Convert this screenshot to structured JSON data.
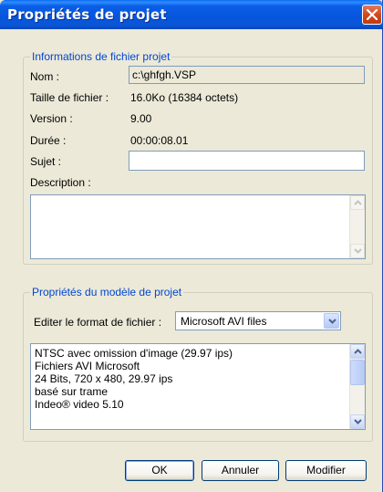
{
  "dialog": {
    "title": "Propriétés de projet"
  },
  "file_info": {
    "legend": "Informations de fichier projet",
    "name_label": "Nom :",
    "name_value": "c:\\ghfgh.VSP",
    "size_label": "Taille de fichier :",
    "size_value": "16.0Ko (16384 octets)",
    "version_label": "Version :",
    "version_value": "9.00",
    "duration_label": "Durée :",
    "duration_value": "00:00:08.01",
    "subject_label": "Sujet :",
    "subject_value": "",
    "description_label": "Description :",
    "description_value": ""
  },
  "template": {
    "legend": "Propriétés du modèle de projet",
    "format_label": "Editer le format de fichier :",
    "format_value": "Microsoft AVI files",
    "details": [
      "NTSC avec omission d'image (29.97 ips)",
      "Fichiers AVI Microsoft",
      "24 Bits, 720 x 480, 29.97 ips",
      "basé sur trame",
      "Indeo® video 5.10"
    ]
  },
  "buttons": {
    "ok": "OK",
    "cancel": "Annuler",
    "modify": "Modifier"
  },
  "colors": {
    "titlebar": "#0a5ee6",
    "close_button": "#d3481f",
    "group_legend": "#0046d5",
    "dialog_bg": "#ece9d8"
  }
}
